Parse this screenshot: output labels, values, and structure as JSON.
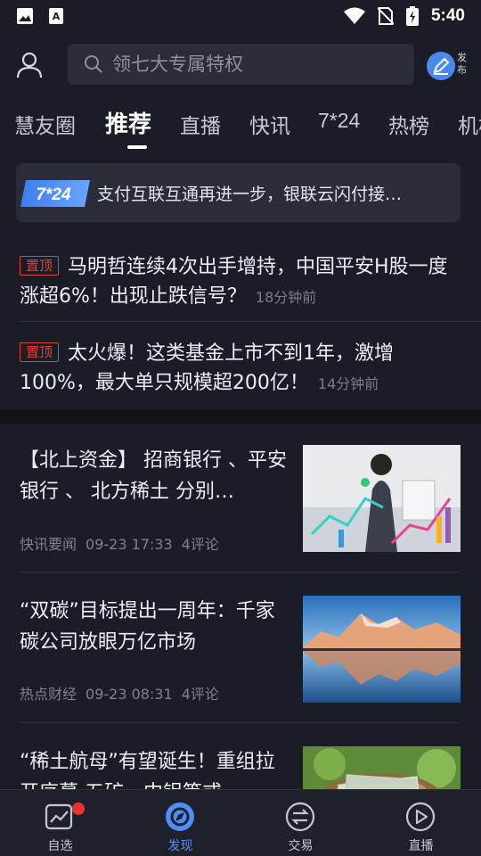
{
  "status_bar": {
    "time": "5:40"
  },
  "header": {
    "search_placeholder": "领七大专属特权",
    "publish_label": "发布"
  },
  "tabs": [
    {
      "label": "慧友圈"
    },
    {
      "label": "推荐",
      "active": true
    },
    {
      "label": "直播"
    },
    {
      "label": "快讯"
    },
    {
      "label": "7*24"
    },
    {
      "label": "热榜"
    },
    {
      "label": "机构"
    }
  ],
  "banner": {
    "badge": "7*24",
    "text": "支付互联互通再进一步，银联云闪付接…"
  },
  "pinned": [
    {
      "tag": "置顶",
      "title": "马明哲连续4次出手增持，中国平安H股一度涨超6%！出现止跌信号？",
      "time": "18分钟前"
    },
    {
      "tag": "置顶",
      "title": "太火爆！这类基金上市不到1年，激增100%，最大单只规模超200亿！",
      "time": "14分钟前"
    }
  ],
  "news": [
    {
      "title": "【北上资金】 招商银行 、平安银行 、 北方稀土 分别…",
      "source": "快讯要闻",
      "time": "09-23 17:33",
      "comments": "4评论",
      "image": "business-woman-chart-photo"
    },
    {
      "title": "“双碳”目标提出一周年：千家碳公司放眼万亿市场",
      "source": "热点财经",
      "time": "09-23 08:31",
      "comments": "4评论",
      "image": "snow-mountain-lake-photo"
    },
    {
      "title": "“稀土航母”有望诞生！重组拉开序幕 五矿、中铝等或…",
      "source": "",
      "time": "",
      "comments": "",
      "image": "money-nest-photo"
    }
  ],
  "bottom_nav": [
    {
      "label": "自选",
      "icon": "chart-icon",
      "badge": true
    },
    {
      "label": "发现",
      "icon": "compass-icon",
      "active": true
    },
    {
      "label": "交易",
      "icon": "exchange-icon"
    },
    {
      "label": "直播",
      "icon": "play-icon"
    }
  ],
  "colors": {
    "background": "#1a1d26",
    "accent": "#4f8ef5",
    "pin_red": "#e2403a"
  }
}
